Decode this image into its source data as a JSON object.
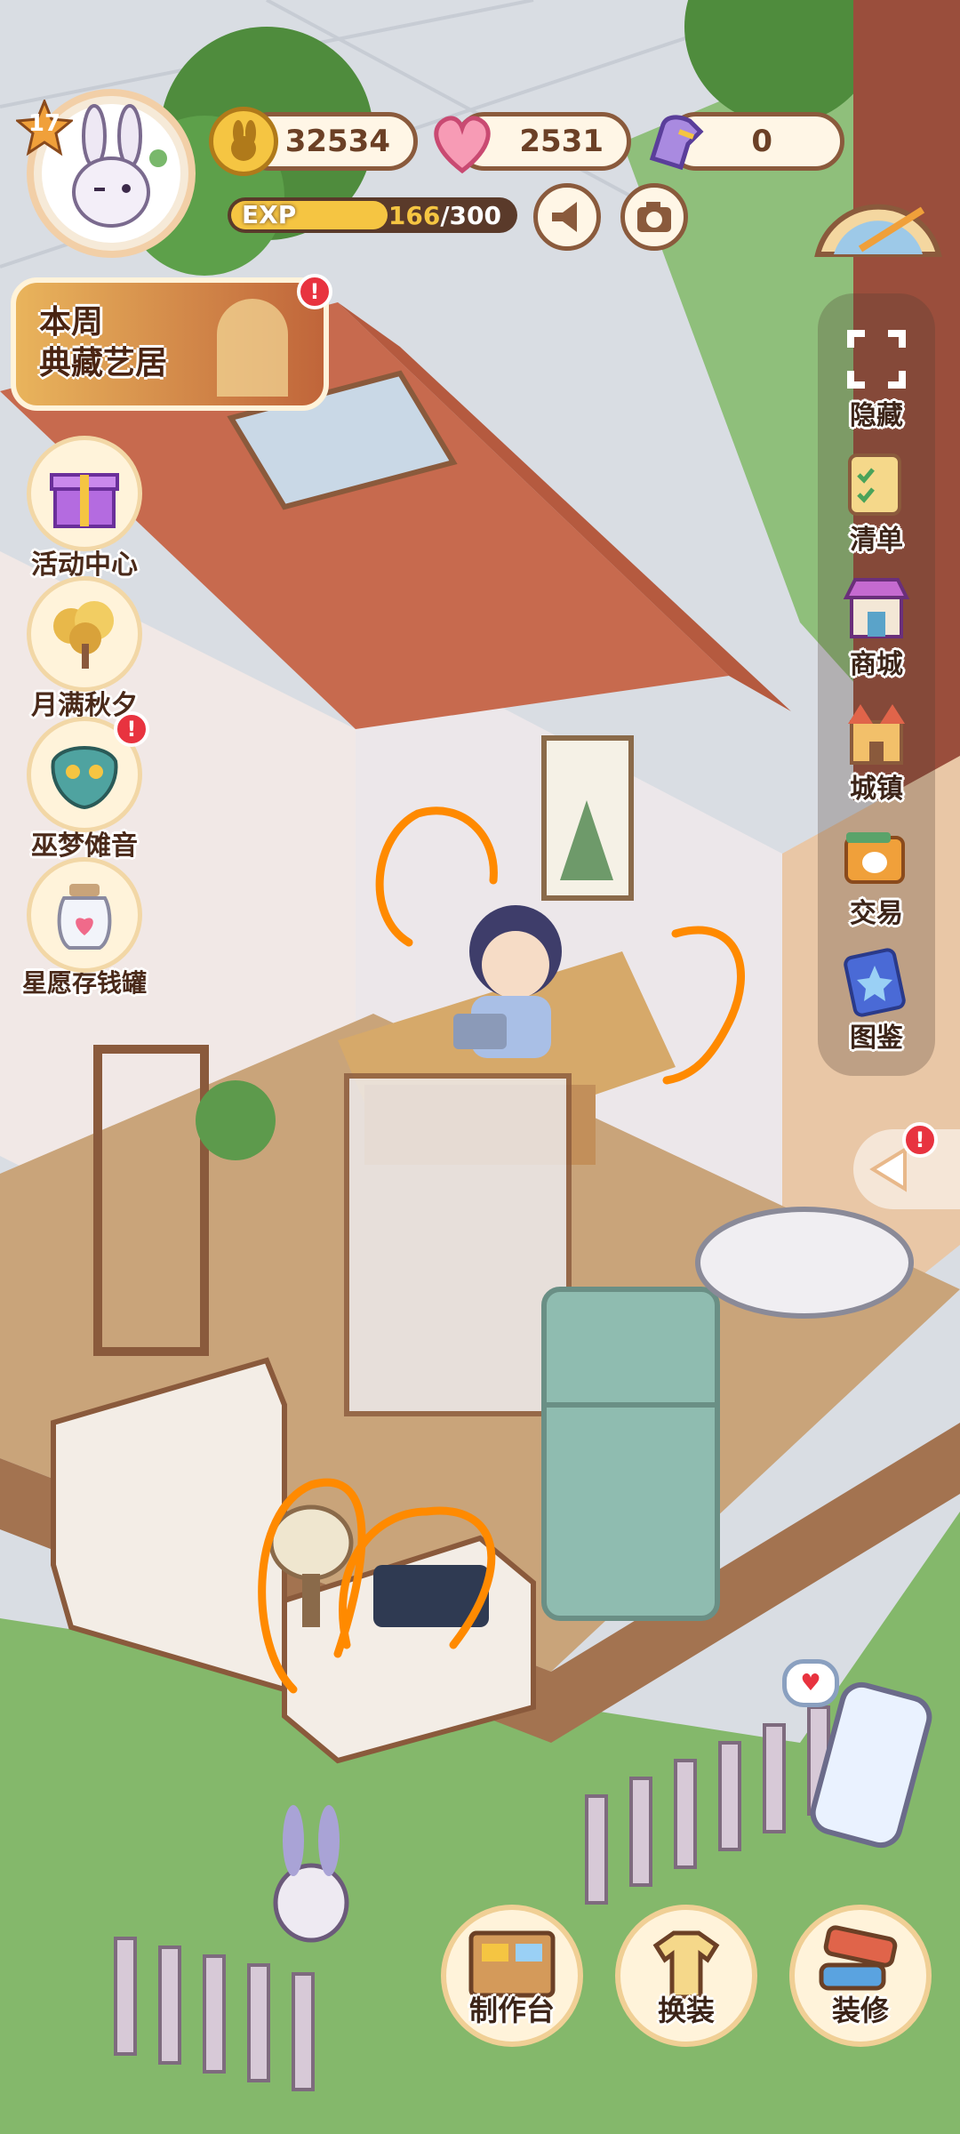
{
  "player": {
    "level": "17",
    "exp_label": "EXP",
    "exp_current": "166",
    "exp_max": "/300",
    "exp_progress": 0.553
  },
  "currencies": [
    {
      "name": "coins",
      "icon": "coin-icon",
      "value": "32534"
    },
    {
      "name": "hearts",
      "icon": "heart-gem-icon",
      "value": "2531"
    },
    {
      "name": "energy",
      "icon": "glove-icon",
      "value": "0"
    }
  ],
  "event_banner": {
    "line1": "本周",
    "line2": "典藏艺居",
    "has_alert": true
  },
  "left_menu": [
    {
      "id": "activity-center",
      "label": "活动中心",
      "icon": "gift-box-icon",
      "has_alert": false
    },
    {
      "id": "moon-autumn",
      "label": "月满秋夕",
      "icon": "osmanthus-tree-icon",
      "has_alert": false
    },
    {
      "id": "witch-dream",
      "label": "巫梦傩音",
      "icon": "mask-icon",
      "has_alert": true
    },
    {
      "id": "wish-jar",
      "label": "星愿存钱罐",
      "icon": "jar-icon",
      "has_alert": false
    }
  ],
  "right_menu": [
    {
      "id": "hide",
      "label": "隐藏",
      "icon": "expand-frame-icon"
    },
    {
      "id": "list",
      "label": "清单",
      "icon": "checklist-icon"
    },
    {
      "id": "shop",
      "label": "商城",
      "icon": "store-icon"
    },
    {
      "id": "town",
      "label": "城镇",
      "icon": "castle-icon"
    },
    {
      "id": "trade",
      "label": "交易",
      "icon": "wallet-icon"
    },
    {
      "id": "codex",
      "label": "图鉴",
      "icon": "star-book-icon"
    }
  ],
  "bottom_menu": [
    {
      "id": "workbench",
      "label": "制作台",
      "icon": "toolbox-icon"
    },
    {
      "id": "outfit",
      "label": "换装",
      "icon": "shirt-icon"
    },
    {
      "id": "decorate",
      "label": "装修",
      "icon": "paint-roller-icon"
    }
  ],
  "colors": {
    "exp_fill": "#f5c542",
    "brand_brown": "#8a5a3c",
    "alert_red": "#e8333f",
    "annotation_orange": "#ff8a00"
  }
}
